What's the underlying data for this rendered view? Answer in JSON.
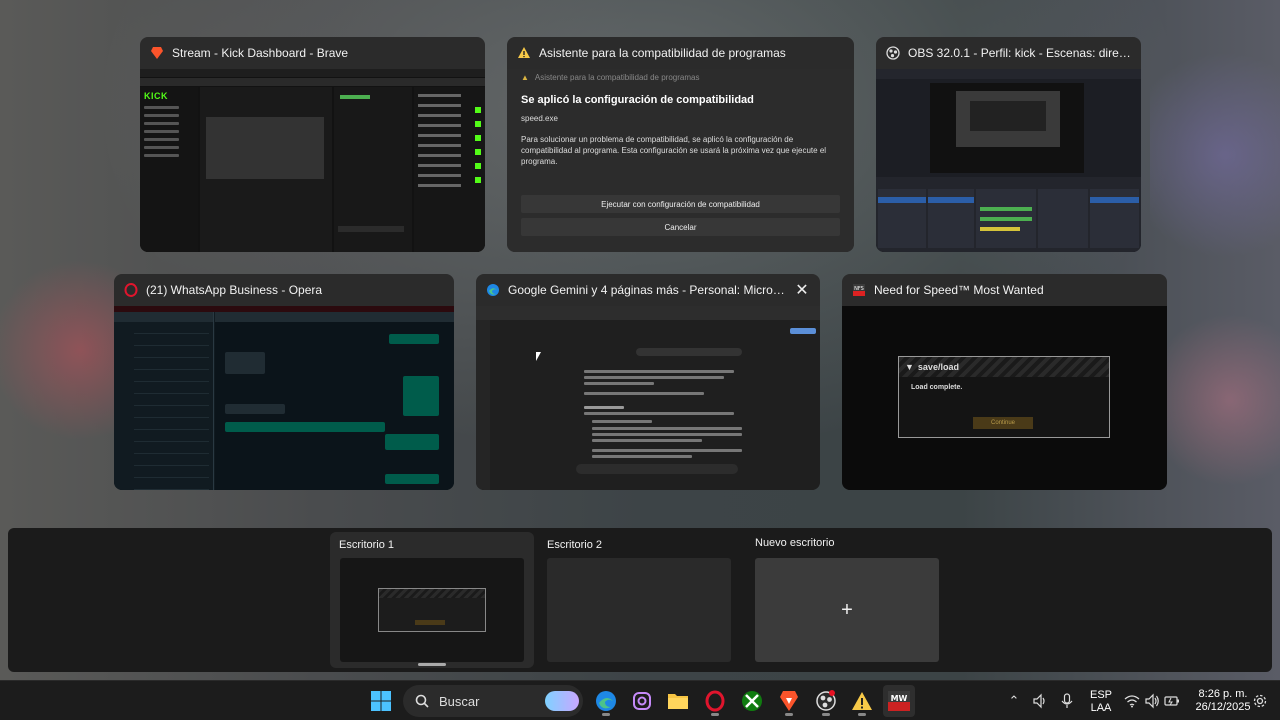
{
  "windows": [
    {
      "title": "Stream - Kick Dashboard - Brave",
      "icon": "brave-icon"
    },
    {
      "title": "Asistente para la compatibilidad de programas",
      "icon": "warning-icon"
    },
    {
      "title": "OBS 32.0.1 - Perfil: kick - Escenas: directo",
      "icon": "obs-icon"
    },
    {
      "title": "(21) WhatsApp Business - Opera",
      "icon": "opera-icon"
    },
    {
      "title": "Google Gemini y 4 páginas más - Personal: Microsoft Edge",
      "icon": "edge-icon"
    },
    {
      "title": "Need for Speed™ Most Wanted",
      "icon": "nfs-icon"
    }
  ],
  "brave_thumb": {
    "logo": "KICK"
  },
  "compat_dialog": {
    "subtitle": "Asistente para la compatibilidad de programas",
    "heading": "Se aplicó la configuración de compatibilidad",
    "app": "speed.exe",
    "description": "Para solucionar un problema de compatibilidad, se aplicó la configuración de compatibilidad al programa. Esta configuración se usará la próxima vez que ejecute el programa.",
    "btn_run": "Ejecutar con configuración de compatibilidad",
    "btn_cancel": "Cancelar"
  },
  "nfs_thumb": {
    "header": "save/load",
    "message": "Load complete.",
    "button": "Continue"
  },
  "desktops": {
    "items": [
      {
        "label": "Escritorio 1"
      },
      {
        "label": "Escritorio 2"
      }
    ],
    "new_label": "Nuevo escritorio",
    "new_icon": "+"
  },
  "taskbar": {
    "search_label": "Buscar",
    "lang_line1": "ESP",
    "lang_line2": "LAA",
    "time": "8:26 p. m.",
    "date": "26/12/2025"
  },
  "colors": {
    "kick_green": "#53fc18",
    "accent": "#5cb8ff"
  }
}
